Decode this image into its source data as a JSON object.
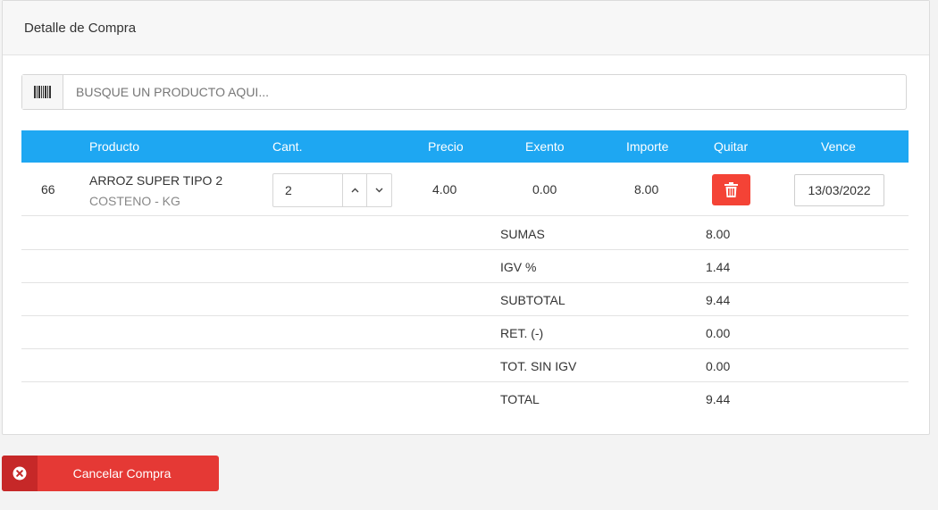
{
  "panel": {
    "title": "Detalle de Compra"
  },
  "search": {
    "placeholder": "BUSQUE UN PRODUCTO AQUI...",
    "value": "",
    "icon": "barcode-icon"
  },
  "table": {
    "headers": {
      "producto": "Producto",
      "cant": "Cant.",
      "precio": "Precio",
      "exento": "Exento",
      "importe": "Importe",
      "quitar": "Quitar",
      "vence": "Vence"
    },
    "rows": [
      {
        "id": "66",
        "name": "ARROZ SUPER TIPO 2",
        "subtitle": "COSTENO - KG",
        "quantity": "2",
        "precio": "4.00",
        "exento": "0.00",
        "importe": "8.00",
        "vence": "13/03/2022"
      }
    ]
  },
  "summary": [
    {
      "label": "SUMAS",
      "value": "8.00"
    },
    {
      "label": "IGV %",
      "value": "1.44"
    },
    {
      "label": "SUBTOTAL",
      "value": "9.44"
    },
    {
      "label": "RET. (-)",
      "value": "0.00"
    },
    {
      "label": "TOT. SIN IGV",
      "value": "0.00"
    },
    {
      "label": "TOTAL",
      "value": "9.44"
    }
  ],
  "actions": {
    "cancel_label": "Cancelar Compra"
  },
  "colors": {
    "header_blue": "#1ea7f2",
    "delete_red": "#f44336",
    "cancel_red": "#e53935",
    "cancel_icon_bg": "#c62828"
  }
}
